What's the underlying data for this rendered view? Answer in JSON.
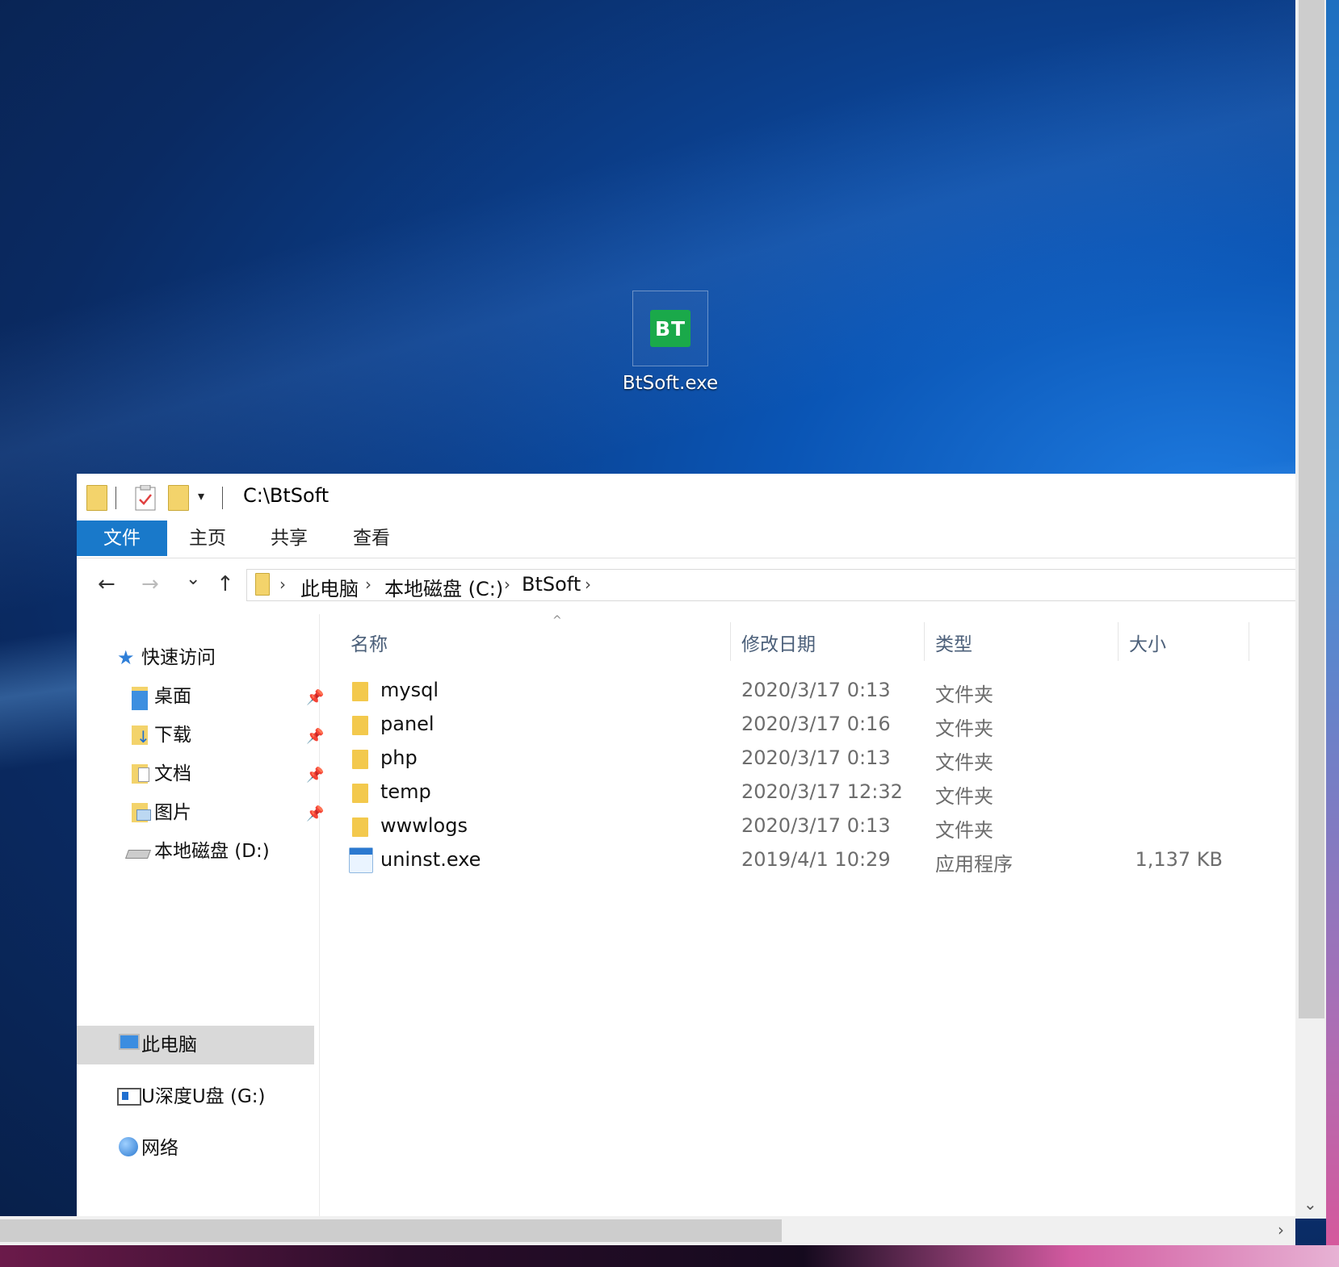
{
  "desktop": {
    "icon_label": "BtSoft.exe",
    "icon_badge": "BT",
    "icon_color": "#1aa94a"
  },
  "window": {
    "title_path": "C:\\BtSoft",
    "quick_access_toolbar": [
      "folder-icon",
      "properties-icon",
      "new-folder-icon",
      "customize-dropdown"
    ],
    "ribbon_tabs": [
      "文件",
      "主页",
      "共享",
      "查看"
    ],
    "accent": "#1979ca",
    "nav": {
      "back": "←",
      "forward": "→",
      "recent": "⌄",
      "up": "↑"
    },
    "breadcrumb": [
      "此电脑",
      "本地磁盘 (C:)",
      "BtSoft"
    ],
    "nav_pane": {
      "quick_access": "快速访问",
      "pinned": [
        "桌面",
        "下载",
        "文档",
        "图片"
      ],
      "drive_d": "本地磁盘 (D:)",
      "this_pc": "此电脑",
      "usb": "U深度U盘 (G:)",
      "network": "网络"
    },
    "columns": [
      "名称",
      "修改日期",
      "类型",
      "大小"
    ],
    "files": [
      {
        "name": "mysql",
        "date": "2020/3/17 0:13",
        "type": "文件夹",
        "size": ""
      },
      {
        "name": "panel",
        "date": "2020/3/17 0:16",
        "type": "文件夹",
        "size": ""
      },
      {
        "name": "php",
        "date": "2020/3/17 0:13",
        "type": "文件夹",
        "size": ""
      },
      {
        "name": "temp",
        "date": "2020/3/17 12:32",
        "type": "文件夹",
        "size": ""
      },
      {
        "name": "wwwlogs",
        "date": "2020/3/17 0:13",
        "type": "文件夹",
        "size": ""
      },
      {
        "name": "uninst.exe",
        "date": "2019/4/1 10:29",
        "type": "应用程序",
        "size": "1,137 KB"
      }
    ]
  }
}
